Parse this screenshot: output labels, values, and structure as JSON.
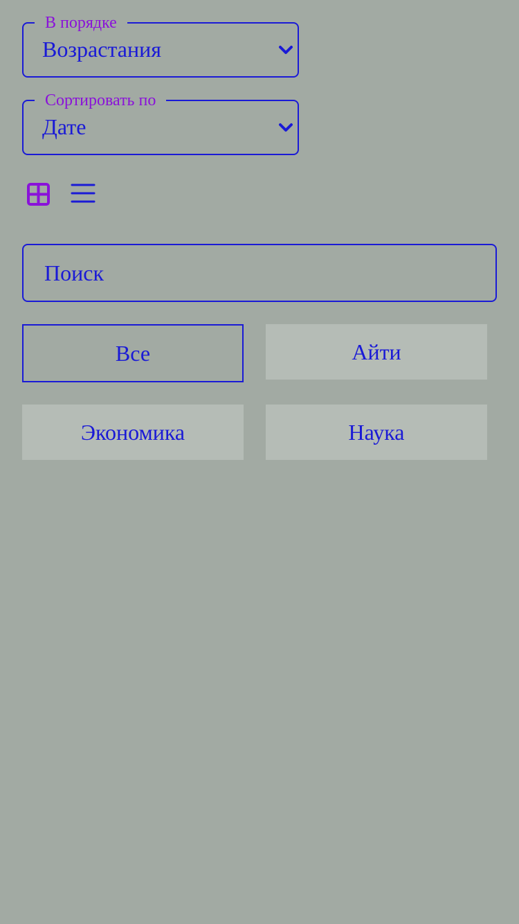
{
  "order": {
    "legend": "В порядке",
    "value": "Возрастания",
    "icon": "chevron-down-icon"
  },
  "sort": {
    "legend": "Сортировать по",
    "value": "Дате",
    "icon": "chevron-down-icon"
  },
  "view": {
    "grid_icon": "grid-view-icon",
    "list_icon": "list-view-icon",
    "active": "grid",
    "active_color": "#8a12d9",
    "inactive_color": "#1a1ad6"
  },
  "search": {
    "placeholder": "Поиск"
  },
  "filters": [
    {
      "label": "Все",
      "active": true
    },
    {
      "label": "Айти",
      "active": false
    },
    {
      "label": "Экономика",
      "active": false
    },
    {
      "label": "Наука",
      "active": false
    }
  ],
  "colors": {
    "background": "#a2aaa3",
    "accent": "#1a1ad6",
    "legend": "#8a12d9",
    "chip": "#b5bcb6"
  }
}
